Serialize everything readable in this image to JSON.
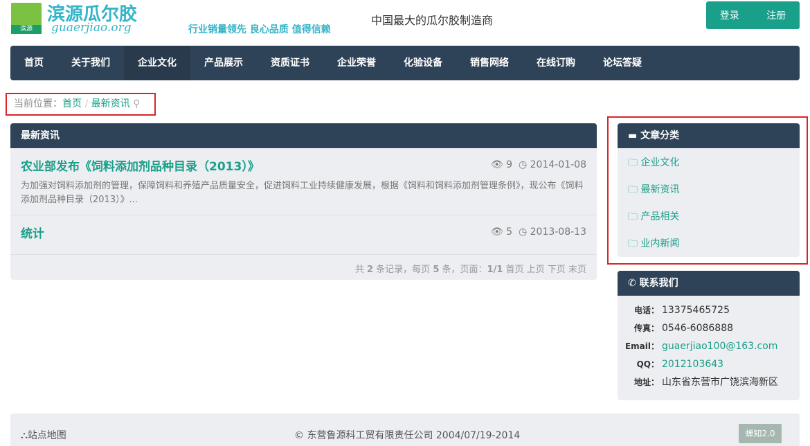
{
  "header": {
    "logo_text": "滨源",
    "brand": "滨源瓜尔胶",
    "domain": "guaerjiao.org",
    "slogan": "行业销量领先  良心品质  值得信赖",
    "tagline": "中国最大的瓜尔胶制造商",
    "login": "登录",
    "register": "注册"
  },
  "nav": [
    "首页",
    "关于我们",
    "企业文化",
    "产品展示",
    "资质证书",
    "企业荣誉",
    "化验设备",
    "销售网络",
    "在线订购",
    "论坛答疑"
  ],
  "breadcrumb": {
    "prefix": "当前位置：",
    "home": "首页",
    "sep": "/",
    "current": "最新资讯"
  },
  "main": {
    "title": "最新资讯",
    "articles": [
      {
        "title": "农业部发布《饲料添加剂品种目录（2013）》",
        "views": "9",
        "date": "2014-01-08",
        "desc": "为加强对饲料添加剂的管理，保障饲料和养殖产品质量安全，促进饲料工业持续健康发展，根据《饲料和饲料添加剂管理条例》，现公布《饲料添加剂品种目录（2013）》..."
      },
      {
        "title": "统计",
        "views": "5",
        "date": "2013-08-13"
      }
    ],
    "pager": {
      "a": "共",
      "total": "2",
      "b": "条记录，每页",
      "per": "5",
      "c": "条，页面：",
      "page": "1/1",
      "first": "首页",
      "prev": "上页",
      "next": "下页",
      "last": "末页"
    }
  },
  "categories": {
    "title": "文章分类",
    "items": [
      "企业文化",
      "最新资讯",
      "产品相关",
      "业内新闻"
    ]
  },
  "contact": {
    "title": "联系我们",
    "rows": [
      {
        "k": "电话：",
        "v": "13375465725"
      },
      {
        "k": "传真：",
        "v": "0546-6086888"
      },
      {
        "k": "Email：",
        "v": "guaerjiao100@163.com"
      },
      {
        "k": "QQ：",
        "v": "2012103643"
      },
      {
        "k": "地址：",
        "v": "山东省东营市广饶滨海新区"
      }
    ]
  },
  "footer": {
    "sitemap": "站点地图",
    "copyright": "© 东营鲁源科工贸有限责任公司 2004/07/19-2014",
    "badge": "蝉知2.0"
  }
}
